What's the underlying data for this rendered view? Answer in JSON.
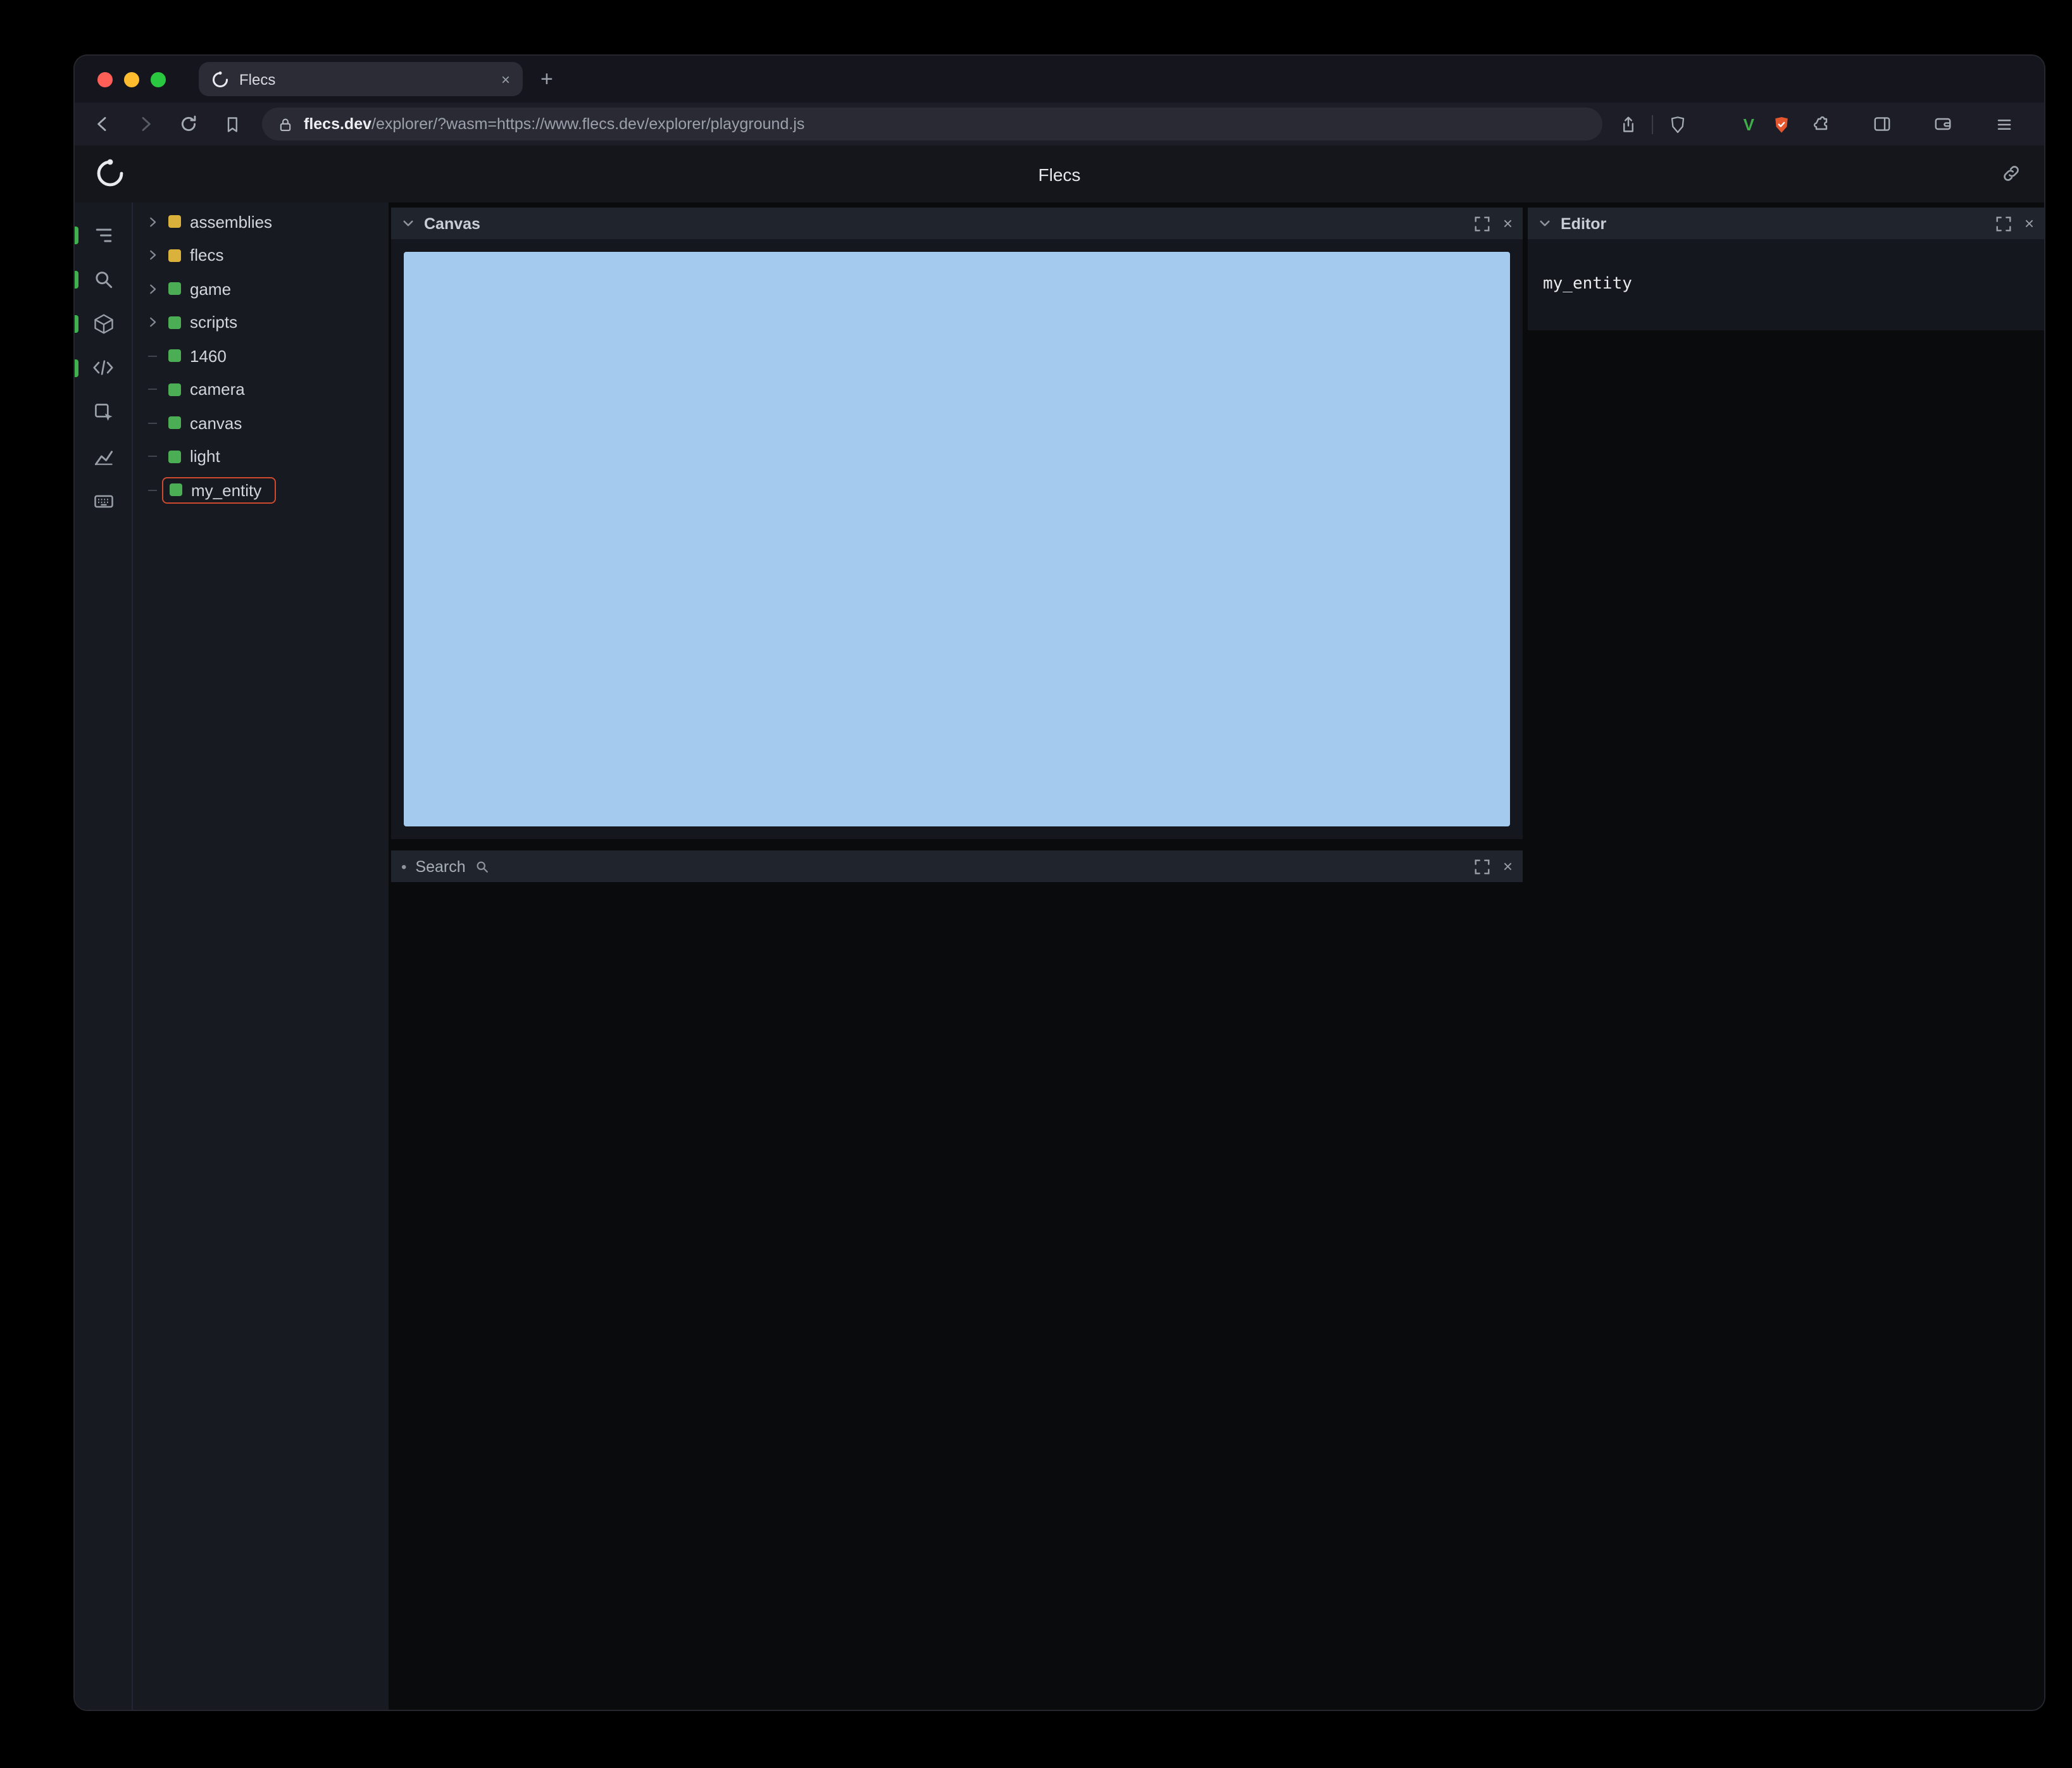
{
  "icons": {
    "close": "×",
    "plus": "+",
    "dot": "•",
    "v_badge": "V"
  },
  "browser": {
    "tab_title": "Flecs",
    "url_domain": "flecs.dev",
    "url_path": "/explorer/?wasm=https://www.flecs.dev/explorer/playground.js"
  },
  "app": {
    "title": "Flecs",
    "tree": {
      "items": [
        {
          "label": "assemblies",
          "color": "#d9b13b",
          "expandable": true
        },
        {
          "label": "flecs",
          "color": "#d9b13b",
          "expandable": true
        },
        {
          "label": "game",
          "color": "#4cae54",
          "expandable": true
        },
        {
          "label": "scripts",
          "color": "#4cae54",
          "expandable": true
        },
        {
          "label": "1460",
          "color": "#4cae54",
          "expandable": false
        },
        {
          "label": "camera",
          "color": "#4cae54",
          "expandable": false
        },
        {
          "label": "canvas",
          "color": "#4cae54",
          "expandable": false
        },
        {
          "label": "light",
          "color": "#4cae54",
          "expandable": false
        },
        {
          "label": "my_entity",
          "color": "#4cae54",
          "expandable": false,
          "selected": true
        }
      ]
    },
    "panels": {
      "canvas": {
        "title": "Canvas"
      },
      "search": {
        "title": "Search"
      },
      "editor": {
        "title": "Editor",
        "content": "my_entity"
      }
    },
    "colors": {
      "canvas_fill": "#a4cbee",
      "annotation_red": "#cd4a2f",
      "entity_green": "#4cae54",
      "module_yellow": "#d9b13b"
    }
  }
}
